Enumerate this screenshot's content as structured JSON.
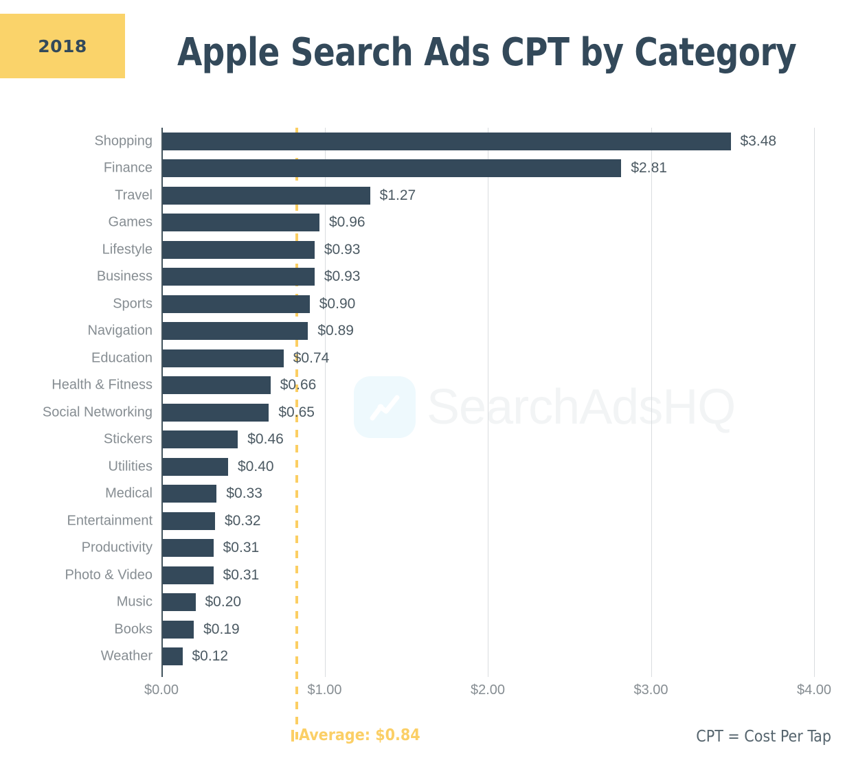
{
  "header": {
    "year_badge": "2018",
    "title": "Apple Search Ads CPT by Category",
    "badge_color": "#fad36a",
    "title_color": "#33495a"
  },
  "watermark": {
    "text": "SearchAdsHQ",
    "logo_icon": "trend-line-icon"
  },
  "footer": {
    "average_note": "Average: $0.84",
    "cpt_note": "CPT = Cost Per Tap"
  },
  "colors": {
    "bar": "#34495a",
    "accent": "#fbcf66",
    "grid": "#d9dcdf",
    "label": "#868d92"
  },
  "chart_data": {
    "type": "bar",
    "orientation": "horizontal",
    "title": "Apple Search Ads CPT by Category",
    "subtitle": "2018",
    "xlabel": "",
    "ylabel": "",
    "xlim": [
      0,
      4
    ],
    "grid": true,
    "legend": null,
    "xticks": [
      "$0.00",
      "$1.00",
      "$2.00",
      "$3.00",
      "$4.00"
    ],
    "xtick_values": [
      0,
      1,
      2,
      3,
      4
    ],
    "average": 0.84,
    "average_label": "Average: $0.84",
    "categories": [
      "Shopping",
      "Finance",
      "Travel",
      "Games",
      "Lifestyle",
      "Business",
      "Sports",
      "Navigation",
      "Education",
      "Health & Fitness",
      "Social Networking",
      "Stickers",
      "Utilities",
      "Medical",
      "Entertainment",
      "Productivity",
      "Photo & Video",
      "Music",
      "Books",
      "Weather"
    ],
    "values": [
      3.48,
      2.81,
      1.27,
      0.96,
      0.93,
      0.93,
      0.9,
      0.89,
      0.74,
      0.66,
      0.65,
      0.46,
      0.4,
      0.33,
      0.32,
      0.31,
      0.31,
      0.2,
      0.19,
      0.12
    ],
    "value_labels": [
      "$3.48",
      "$2.81",
      "$1.27",
      "$0.96",
      "$0.93",
      "$0.93",
      "$0.90",
      "$0.89",
      "$0.74",
      "$0.66",
      "$0.65",
      "$0.46",
      "$0.40",
      "$0.33",
      "$0.32",
      "$0.31",
      "$0.31",
      "$0.20",
      "$0.19",
      "$0.12"
    ],
    "annotations": [
      "CPT = Cost Per Tap"
    ]
  }
}
